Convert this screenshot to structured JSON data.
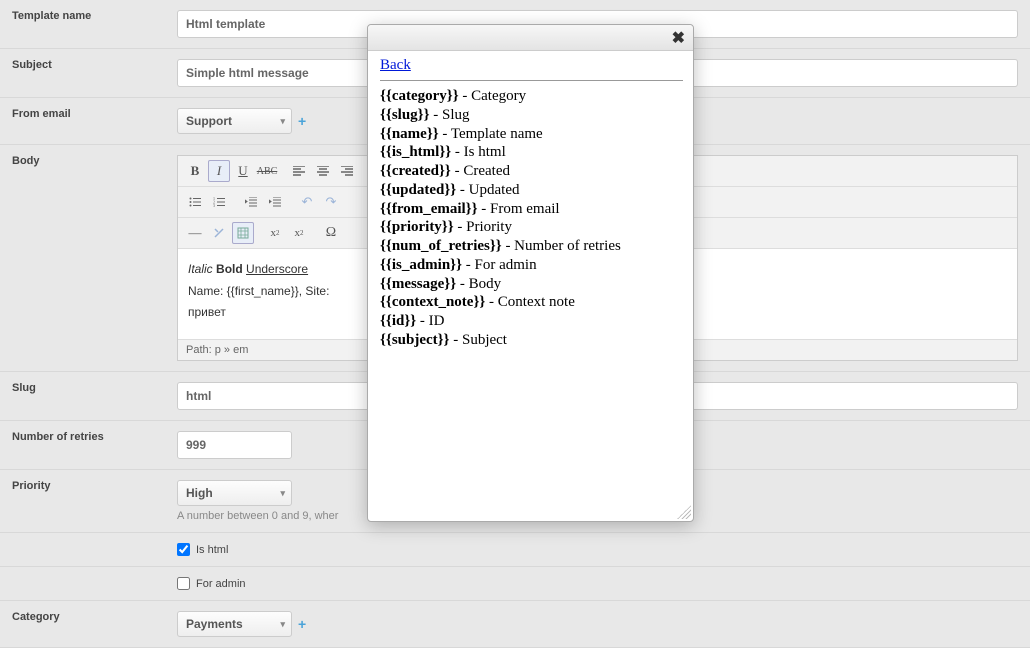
{
  "fields": {
    "template_name": {
      "label": "Template name",
      "value": "Html template"
    },
    "subject": {
      "label": "Subject",
      "value": "Simple html message"
    },
    "from_email": {
      "label": "From email",
      "value": "Support"
    },
    "body": {
      "label": "Body"
    },
    "slug": {
      "label": "Slug",
      "value": "html"
    },
    "retries": {
      "label": "Number of retries",
      "value": "999"
    },
    "priority": {
      "label": "Priority",
      "value": "High",
      "help": "A number between 0 and 9, wher"
    },
    "is_html": {
      "label": "Is html",
      "checked": true
    },
    "for_admin": {
      "label": "For admin",
      "checked": false
    },
    "category": {
      "label": "Category",
      "value": "Payments"
    }
  },
  "editor": {
    "sample_italic": "Italic",
    "sample_bold": "Bold",
    "sample_under": "Underscore",
    "line2": "Name: {{first_name}}, Site:",
    "line3": "привет",
    "path": "Path: p » em"
  },
  "modal": {
    "back": "Back",
    "vars": [
      {
        "tag": "{{category}}",
        "desc": "Category"
      },
      {
        "tag": "{{slug}}",
        "desc": "Slug"
      },
      {
        "tag": "{{name}}",
        "desc": "Template name"
      },
      {
        "tag": "{{is_html}}",
        "desc": "Is html"
      },
      {
        "tag": "{{created}}",
        "desc": "Created"
      },
      {
        "tag": "{{updated}}",
        "desc": "Updated"
      },
      {
        "tag": "{{from_email}}",
        "desc": "From email"
      },
      {
        "tag": "{{priority}}",
        "desc": "Priority"
      },
      {
        "tag": "{{num_of_retries}}",
        "desc": "Number of retries"
      },
      {
        "tag": "{{is_admin}}",
        "desc": "For admin"
      },
      {
        "tag": "{{message}}",
        "desc": "Body"
      },
      {
        "tag": "{{context_note}}",
        "desc": "Context note"
      },
      {
        "tag": "{{id}}",
        "desc": "ID"
      },
      {
        "tag": "{{subject}}",
        "desc": "Subject"
      }
    ]
  }
}
